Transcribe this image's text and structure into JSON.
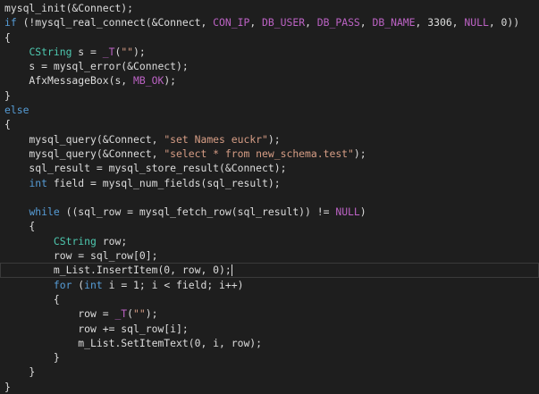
{
  "editor": {
    "lines": [
      [
        {
          "t": "mysql_init(&Connect);",
          "c": "plain"
        }
      ],
      [
        {
          "t": "if",
          "c": "kw"
        },
        {
          "t": " (!mysql_real_connect(&Connect, ",
          "c": "plain"
        },
        {
          "t": "CON_IP",
          "c": "mac"
        },
        {
          "t": ", ",
          "c": "plain"
        },
        {
          "t": "DB_USER",
          "c": "mac"
        },
        {
          "t": ", ",
          "c": "plain"
        },
        {
          "t": "DB_PASS",
          "c": "mac"
        },
        {
          "t": ", ",
          "c": "plain"
        },
        {
          "t": "DB_NAME",
          "c": "mac"
        },
        {
          "t": ", 3306, ",
          "c": "plain"
        },
        {
          "t": "NULL",
          "c": "mac"
        },
        {
          "t": ", 0))",
          "c": "plain"
        }
      ],
      [
        {
          "t": "{",
          "c": "plain"
        }
      ],
      [
        {
          "t": "    ",
          "c": "plain"
        },
        {
          "t": "CString",
          "c": "type"
        },
        {
          "t": " s = ",
          "c": "plain"
        },
        {
          "t": "_T",
          "c": "mac"
        },
        {
          "t": "(",
          "c": "plain"
        },
        {
          "t": "\"\"",
          "c": "str"
        },
        {
          "t": ");",
          "c": "plain"
        }
      ],
      [
        {
          "t": "    s = mysql_error(&Connect);",
          "c": "plain"
        }
      ],
      [
        {
          "t": "    AfxMessageBox(s, ",
          "c": "plain"
        },
        {
          "t": "MB_OK",
          "c": "mac"
        },
        {
          "t": ");",
          "c": "plain"
        }
      ],
      [
        {
          "t": "}",
          "c": "plain"
        }
      ],
      [
        {
          "t": "else",
          "c": "kw"
        }
      ],
      [
        {
          "t": "{",
          "c": "plain"
        }
      ],
      [
        {
          "t": "    mysql_query(&Connect, ",
          "c": "plain"
        },
        {
          "t": "\"set Names euckr\"",
          "c": "str"
        },
        {
          "t": ");",
          "c": "plain"
        }
      ],
      [
        {
          "t": "    mysql_query(&Connect, ",
          "c": "plain"
        },
        {
          "t": "\"select * from new_schema.test\"",
          "c": "str"
        },
        {
          "t": ");",
          "c": "plain"
        }
      ],
      [
        {
          "t": "    sql_result = mysql_store_result(&Connect);",
          "c": "plain"
        }
      ],
      [
        {
          "t": "    ",
          "c": "plain"
        },
        {
          "t": "int",
          "c": "kw"
        },
        {
          "t": " field = mysql_num_fields(sql_result);",
          "c": "plain"
        }
      ],
      [
        {
          "t": "",
          "c": "plain"
        }
      ],
      [
        {
          "t": "    ",
          "c": "plain"
        },
        {
          "t": "while",
          "c": "kw"
        },
        {
          "t": " ((sql_row = mysql_fetch_row(sql_result)) != ",
          "c": "plain"
        },
        {
          "t": "NULL",
          "c": "mac"
        },
        {
          "t": ")",
          "c": "plain"
        }
      ],
      [
        {
          "t": "    {",
          "c": "plain"
        }
      ],
      [
        {
          "t": "        ",
          "c": "plain"
        },
        {
          "t": "CString",
          "c": "type"
        },
        {
          "t": " row;",
          "c": "plain"
        }
      ],
      [
        {
          "t": "        row = sql_row[0];",
          "c": "plain"
        }
      ],
      [
        {
          "t": "        m_List.InsertItem(0, row, 0);",
          "c": "plain"
        }
      ],
      [
        {
          "t": "        ",
          "c": "plain"
        },
        {
          "t": "for",
          "c": "kw"
        },
        {
          "t": " (",
          "c": "plain"
        },
        {
          "t": "int",
          "c": "kw"
        },
        {
          "t": " i = 1; i < field; i++)",
          "c": "plain"
        }
      ],
      [
        {
          "t": "        {",
          "c": "plain"
        }
      ],
      [
        {
          "t": "            row = ",
          "c": "plain"
        },
        {
          "t": "_T",
          "c": "mac"
        },
        {
          "t": "(",
          "c": "plain"
        },
        {
          "t": "\"\"",
          "c": "str"
        },
        {
          "t": ");",
          "c": "plain"
        }
      ],
      [
        {
          "t": "            row += sql_row[i];",
          "c": "plain"
        }
      ],
      [
        {
          "t": "            m_List.SetItemText(0, i, row);",
          "c": "plain"
        }
      ],
      [
        {
          "t": "        }",
          "c": "plain"
        }
      ],
      [
        {
          "t": "    }",
          "c": "plain"
        }
      ],
      [
        {
          "t": "}",
          "c": "plain"
        }
      ]
    ],
    "current_line": 18
  }
}
